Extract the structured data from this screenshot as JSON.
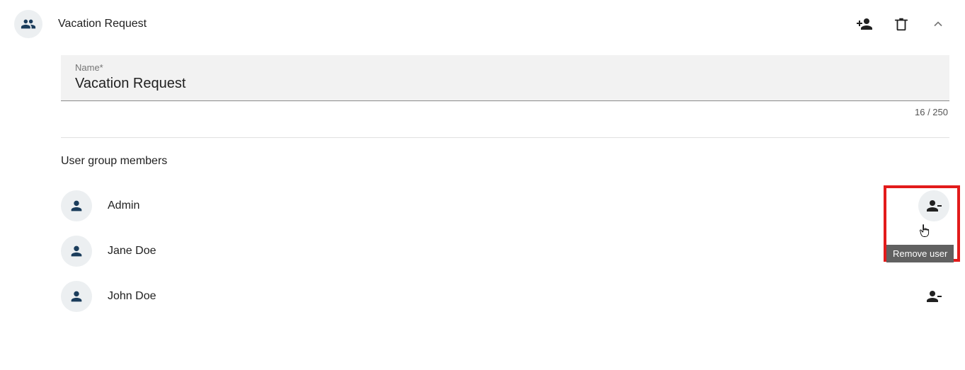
{
  "header": {
    "title": "Vacation Request"
  },
  "nameField": {
    "label": "Name*",
    "value": "Vacation Request",
    "counter": "16 / 250"
  },
  "section": {
    "title": "User group members"
  },
  "members": [
    {
      "name": "Admin"
    },
    {
      "name": "Jane Doe"
    },
    {
      "name": "John Doe"
    }
  ],
  "tooltip": "Remove user"
}
